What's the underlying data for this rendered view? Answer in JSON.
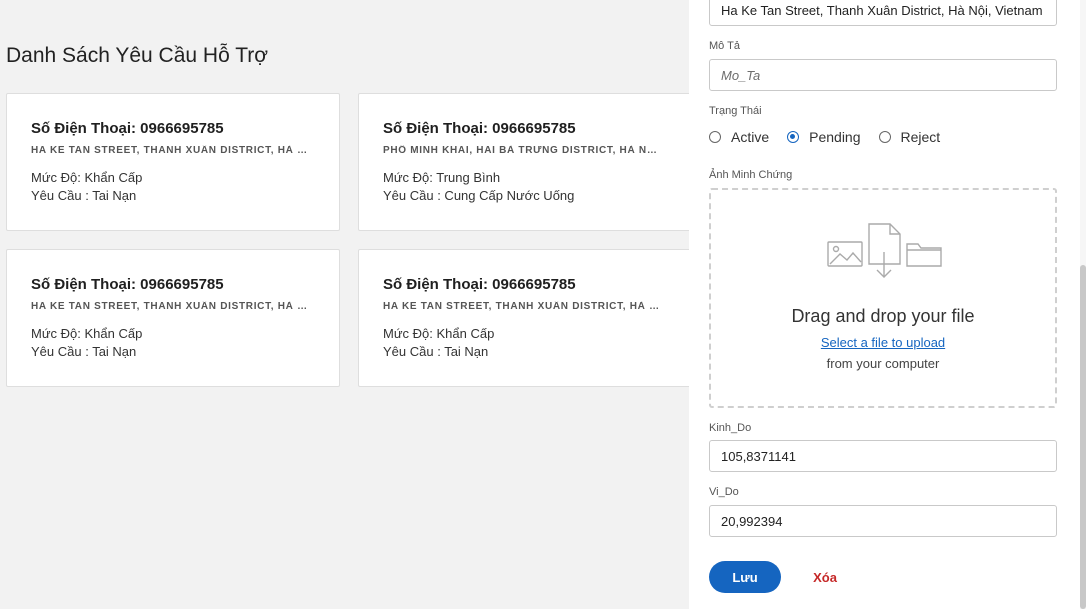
{
  "list": {
    "title": "Danh Sách Yêu Cầu Hỗ Trợ",
    "cards": [
      {
        "phone": "Số Điện Thoại: 0966695785",
        "address": "HA KE TAN STREET, THANH XUÂN DISTRICT, HÀ NỘI, VIETNAM",
        "level": "Mức Độ: Khẩn Cấp",
        "request": "Yêu Cầu : Tai Nạn"
      },
      {
        "phone": "Số Điện Thoại: 0966695785",
        "address": "PHỐ MINH KHAI, HAI BÀ TRƯNG DISTRICT, HÀ NỘI, VIETNAM",
        "level": "Mức Độ: Trung Bình",
        "request": "Yêu Cầu : Cung Cấp Nước Uống"
      },
      {
        "phone": "Số Điện Thoại: 0966695785",
        "address": "HA KE TAN STREET, THANH XUÂN DISTRICT, HÀ NỘI, VIETNAM",
        "level": "Mức Độ: Khẩn Cấp",
        "request": "Yêu Cầu : Tai Nạn"
      },
      {
        "phone": "Số Điện Thoại: 0966695785",
        "address": "HA KE TAN STREET, THANH XUÂN DISTRICT, HÀ NỘI, VIETNAM",
        "level": "Mức Độ: Khẩn Cấp",
        "request": "Yêu Cầu : Tai Nạn"
      }
    ]
  },
  "form": {
    "address_value": "Ha Ke Tan Street, Thanh Xuân District, Hà Nội, Vietnam",
    "description_label": "Mô Tả",
    "description_placeholder": "Mo_Ta",
    "status_label": "Trạng Thái",
    "status_options": [
      "Active",
      "Pending",
      "Reject"
    ],
    "status_selected": "Pending",
    "evidence_label": "Ảnh Minh Chứng",
    "dropzone": {
      "title": "Drag and drop your file",
      "link": "Select a file to upload",
      "subtitle": "from your computer",
      "icons": [
        "image-icon",
        "document-download-icon",
        "folder-icon"
      ]
    },
    "longitude_label": "Kinh_Do",
    "longitude_value": "105,8371141",
    "latitude_label": "Vi_Do",
    "latitude_value": "20,992394",
    "save_label": "Lưu",
    "delete_label": "Xóa"
  },
  "colors": {
    "primary": "#1565c0",
    "danger": "#c62828",
    "background": "#f2f2f2"
  }
}
